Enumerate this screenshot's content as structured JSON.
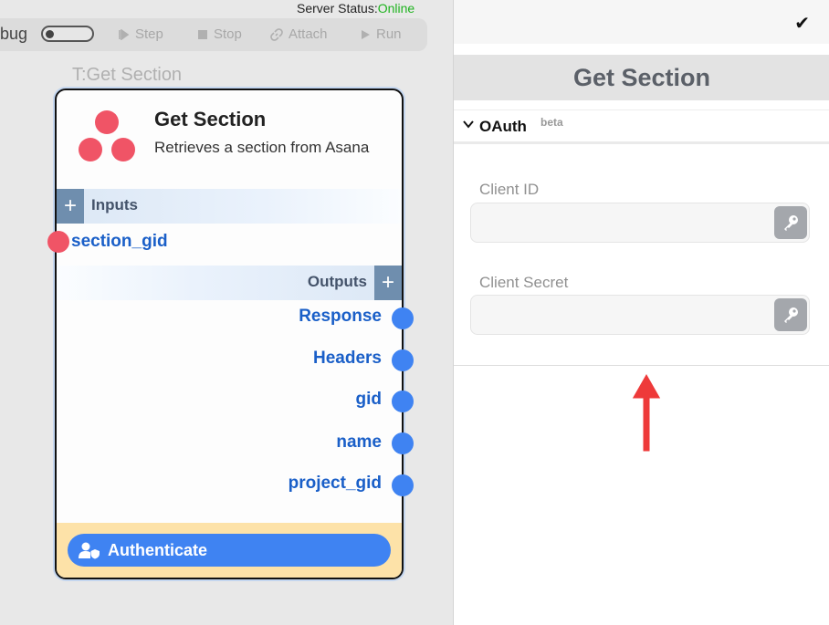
{
  "server_status": {
    "label": "Server Status:",
    "value": "Online",
    "color": "#1fb31f"
  },
  "toolbar": {
    "debug_label": "bug",
    "step_label": "Step",
    "stop_label": "Stop",
    "attach_label": "Attach",
    "run_label": "Run"
  },
  "node": {
    "outside_title": "T:Get Section",
    "name": "Get Section",
    "description": "Retrieves a section from Asana",
    "logo_icon": "asana-logo",
    "inputs_label": "Inputs",
    "outputs_label": "Outputs",
    "inputs": [
      "section_gid"
    ],
    "outputs": [
      "Response",
      "Headers",
      "gid",
      "name",
      "project_gid"
    ],
    "authenticate_label": "Authenticate"
  },
  "panel": {
    "title": "Get Section",
    "oauth_title": "OAuth",
    "oauth_badge": "beta",
    "client_id_label": "Client ID",
    "client_id_value": "",
    "client_secret_label": "Client Secret",
    "client_secret_value": ""
  },
  "colors": {
    "accent_blue": "#3f83f2",
    "port_red": "#f05466",
    "auth_footer": "#fde2a8",
    "arrow_red": "#ee3a3a"
  }
}
